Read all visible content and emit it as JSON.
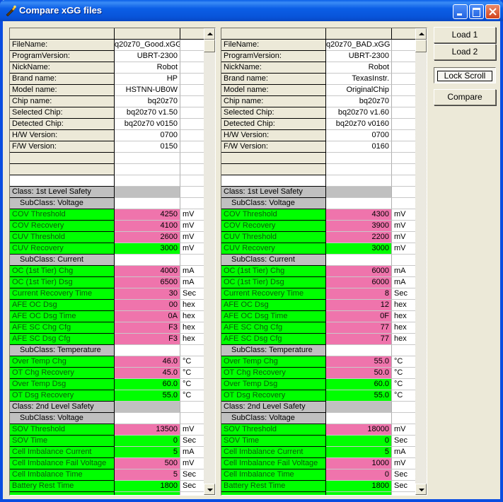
{
  "window": {
    "title": "Compare xGG files"
  },
  "buttons": {
    "load1": "Load 1",
    "load2": "Load 2",
    "lock_scroll": "Lock Scroll",
    "compare": "Compare"
  },
  "colors": {
    "match": "#00ff00",
    "mismatch": "#ef74ac",
    "section": "#c0c0c0"
  },
  "left": {
    "info": [
      {
        "label": "FileName:",
        "value": "q20z70_Good.xGG"
      },
      {
        "label": "ProgramVersion:",
        "value": "UBRT-2300"
      },
      {
        "label": "NickName:",
        "value": "Robot"
      },
      {
        "label": "Brand name:",
        "value": "HP"
      },
      {
        "label": "Model name:",
        "value": "HSTNN-UB0W"
      },
      {
        "label": "Chip name:",
        "value": "bq20z70"
      },
      {
        "label": "Selected Chip:",
        "value": "bq20z70 v1.50"
      },
      {
        "label": "Detected Chip:",
        "value": "bq20z70 v0150"
      },
      {
        "label": "H/W Version:",
        "value": "0700"
      },
      {
        "label": "F/W Version:",
        "value": "0150"
      }
    ],
    "params": [
      {
        "type": "class",
        "label": "Class: 1st Level Safety"
      },
      {
        "type": "sub",
        "label": "SubClass: Voltage"
      },
      {
        "type": "p",
        "label": "COV Threshold",
        "value": "4250",
        "unit": "mV",
        "diff": true
      },
      {
        "type": "p",
        "label": "COV Recovery",
        "value": "4100",
        "unit": "mV",
        "diff": true
      },
      {
        "type": "p",
        "label": "CUV Threshold",
        "value": "2600",
        "unit": "mV",
        "diff": true
      },
      {
        "type": "p",
        "label": "CUV Recovery",
        "value": "3000",
        "unit": "mV",
        "diff": false
      },
      {
        "type": "sub",
        "label": "SubClass: Current"
      },
      {
        "type": "p",
        "label": "OC (1st Tier) Chg",
        "value": "4000",
        "unit": "mA",
        "diff": true
      },
      {
        "type": "p",
        "label": "OC (1st Tier) Dsg",
        "value": "6500",
        "unit": "mA",
        "diff": true
      },
      {
        "type": "p",
        "label": "Current Recovery Time",
        "value": "30",
        "unit": "Sec",
        "diff": true
      },
      {
        "type": "p",
        "label": "AFE OC Dsg",
        "value": "00",
        "unit": "hex",
        "diff": true
      },
      {
        "type": "p",
        "label": "AFE OC Dsg Time",
        "value": "0A",
        "unit": "hex",
        "diff": true
      },
      {
        "type": "p",
        "label": "AFE SC Chg Cfg",
        "value": "F3",
        "unit": "hex",
        "diff": true
      },
      {
        "type": "p",
        "label": "AFE SC Dsg Cfg",
        "value": "F3",
        "unit": "hex",
        "diff": true
      },
      {
        "type": "sub",
        "label": "SubClass: Temperature"
      },
      {
        "type": "p",
        "label": "Over Temp Chg",
        "value": "46.0",
        "unit": "°C",
        "diff": true
      },
      {
        "type": "p",
        "label": "OT Chg Recovery",
        "value": "45.0",
        "unit": "°C",
        "diff": true
      },
      {
        "type": "p",
        "label": "Over Temp Dsg",
        "value": "60.0",
        "unit": "°C",
        "diff": false
      },
      {
        "type": "p",
        "label": "OT Dsg Recovery",
        "value": "55.0",
        "unit": "°C",
        "diff": false
      },
      {
        "type": "class",
        "label": "Class: 2nd Level Safety"
      },
      {
        "type": "sub",
        "label": "SubClass: Voltage"
      },
      {
        "type": "p",
        "label": "SOV Threshold",
        "value": "13500",
        "unit": "mV",
        "diff": true
      },
      {
        "type": "p",
        "label": "SOV Time",
        "value": "0",
        "unit": "Sec",
        "diff": false
      },
      {
        "type": "p",
        "label": "Cell Imbalance Current",
        "value": "5",
        "unit": "mA",
        "diff": false
      },
      {
        "type": "p",
        "label": "Cell Imbalance Fail Voltage",
        "value": "500",
        "unit": "mV",
        "diff": true
      },
      {
        "type": "p",
        "label": "Cell Imbalance Time",
        "value": "5",
        "unit": "Sec",
        "diff": true
      },
      {
        "type": "p",
        "label": "Battery Rest Time",
        "value": "1800",
        "unit": "Sec",
        "diff": false
      }
    ]
  },
  "right": {
    "info": [
      {
        "label": "FileName:",
        "value": "q20z70_BAD.xGG"
      },
      {
        "label": "ProgramVersion:",
        "value": "UBRT-2300"
      },
      {
        "label": "NickName:",
        "value": "Robot"
      },
      {
        "label": "Brand name:",
        "value": "TexasInstr."
      },
      {
        "label": "Model name:",
        "value": "OriginalChip"
      },
      {
        "label": "Chip name:",
        "value": "bq20z70"
      },
      {
        "label": "Selected Chip:",
        "value": "bq20z70 v1.60"
      },
      {
        "label": "Detected Chip:",
        "value": "bq20z70 v0160"
      },
      {
        "label": "H/W Version:",
        "value": "0700"
      },
      {
        "label": "F/W Version:",
        "value": "0160"
      }
    ],
    "params": [
      {
        "type": "class",
        "label": "Class: 1st Level Safety"
      },
      {
        "type": "sub",
        "label": "SubClass: Voltage"
      },
      {
        "type": "p",
        "label": "COV Threshold",
        "value": "4300",
        "unit": "mV",
        "diff": true
      },
      {
        "type": "p",
        "label": "COV Recovery",
        "value": "3900",
        "unit": "mV",
        "diff": true
      },
      {
        "type": "p",
        "label": "CUV Threshold",
        "value": "2200",
        "unit": "mV",
        "diff": true
      },
      {
        "type": "p",
        "label": "CUV Recovery",
        "value": "3000",
        "unit": "mV",
        "diff": false
      },
      {
        "type": "sub",
        "label": "SubClass: Current"
      },
      {
        "type": "p",
        "label": "OC (1st Tier) Chg",
        "value": "6000",
        "unit": "mA",
        "diff": true
      },
      {
        "type": "p",
        "label": "OC (1st Tier) Dsg",
        "value": "6000",
        "unit": "mA",
        "diff": true
      },
      {
        "type": "p",
        "label": "Current Recovery Time",
        "value": "8",
        "unit": "Sec",
        "diff": true
      },
      {
        "type": "p",
        "label": "AFE OC Dsg",
        "value": "12",
        "unit": "hex",
        "diff": true
      },
      {
        "type": "p",
        "label": "AFE OC Dsg Time",
        "value": "0F",
        "unit": "hex",
        "diff": true
      },
      {
        "type": "p",
        "label": "AFE SC Chg Cfg",
        "value": "77",
        "unit": "hex",
        "diff": true
      },
      {
        "type": "p",
        "label": "AFE SC Dsg Cfg",
        "value": "77",
        "unit": "hex",
        "diff": true
      },
      {
        "type": "sub",
        "label": "SubClass: Temperature"
      },
      {
        "type": "p",
        "label": "Over Temp Chg",
        "value": "55.0",
        "unit": "°C",
        "diff": true
      },
      {
        "type": "p",
        "label": "OT Chg Recovery",
        "value": "50.0",
        "unit": "°C",
        "diff": true
      },
      {
        "type": "p",
        "label": "Over Temp Dsg",
        "value": "60.0",
        "unit": "°C",
        "diff": false
      },
      {
        "type": "p",
        "label": "OT Dsg Recovery",
        "value": "55.0",
        "unit": "°C",
        "diff": false
      },
      {
        "type": "class",
        "label": "Class: 2nd Level Safety"
      },
      {
        "type": "sub",
        "label": "SubClass: Voltage"
      },
      {
        "type": "p",
        "label": "SOV Threshold",
        "value": "18000",
        "unit": "mV",
        "diff": true
      },
      {
        "type": "p",
        "label": "SOV Time",
        "value": "0",
        "unit": "Sec",
        "diff": false
      },
      {
        "type": "p",
        "label": "Cell Imbalance Current",
        "value": "5",
        "unit": "mA",
        "diff": false
      },
      {
        "type": "p",
        "label": "Cell Imbalance Fail Voltage",
        "value": "1000",
        "unit": "mV",
        "diff": true
      },
      {
        "type": "p",
        "label": "Cell Imbalance Time",
        "value": "0",
        "unit": "Sec",
        "diff": true
      },
      {
        "type": "p",
        "label": "Battery Rest Time",
        "value": "1800",
        "unit": "Sec",
        "diff": false
      }
    ]
  }
}
